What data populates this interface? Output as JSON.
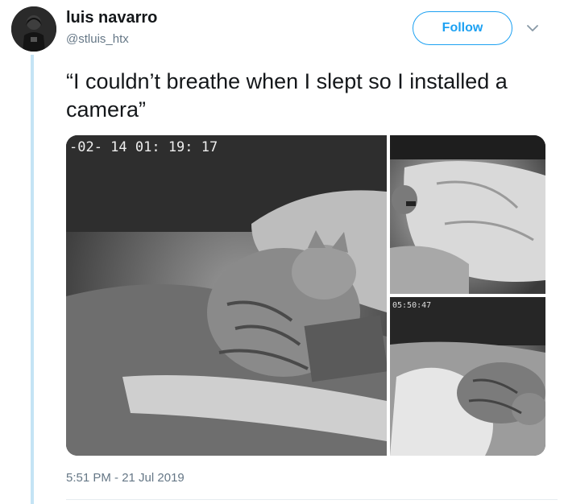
{
  "tweet": {
    "author_name": "luis navarro",
    "author_handle": "@stluis_htx",
    "follow_label": "Follow",
    "text": "“I couldn’t breathe when I slept so I installed a camera”",
    "timestamp": "5:51 PM - 21 Jul 2019"
  },
  "media": {
    "photos": [
      {
        "subject": "cat sitting on sleeping person's chest, night vision camera",
        "overlay_text": "-02- 14  01: 19: 17"
      },
      {
        "subject": "person sleeping, night vision camera"
      },
      {
        "subject": "cat lying on sleeping person, night vision camera",
        "overlay_text": "05:50:47"
      }
    ]
  },
  "colors": {
    "accent": "#1da1f2",
    "text_primary": "#14171a",
    "text_secondary": "#657786",
    "thread_line": "#c4e4f5"
  },
  "icons": {
    "more": "chevron-down-icon"
  }
}
